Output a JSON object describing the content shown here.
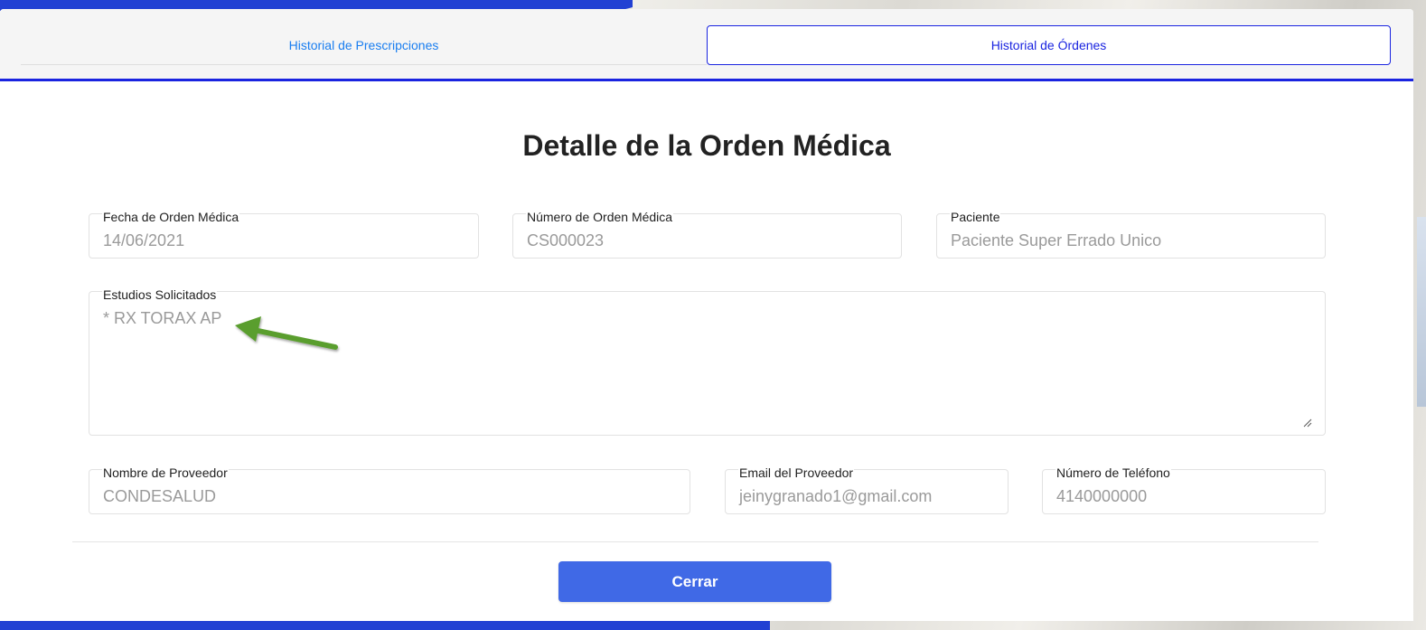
{
  "tabs": [
    {
      "label": "Historial de Prescripciones",
      "active": false
    },
    {
      "label": "Historial de Órdenes",
      "active": true
    }
  ],
  "title": "Detalle de la Orden Médica",
  "fields": {
    "fecha": {
      "label": "Fecha de Orden Médica",
      "value": "14/06/2021"
    },
    "numero": {
      "label": "Número de Orden Médica",
      "value": "CS000023"
    },
    "paciente": {
      "label": "Paciente",
      "value": "Paciente Super Errado Unico"
    },
    "estudios": {
      "label": "Estudios Solicitados",
      "value": "* RX TORAX AP"
    },
    "proveedor": {
      "label": "Nombre de Proveedor",
      "value": "CONDESALUD"
    },
    "email": {
      "label": "Email del Proveedor",
      "value": "jeinygranado1@gmail.com"
    },
    "telefono": {
      "label": "Número de Teléfono",
      "value": "4140000000"
    }
  },
  "close_label": "Cerrar",
  "colors": {
    "accent": "#1a24e0",
    "tab_link": "#1a7ef0",
    "button": "#4069e6",
    "annotation_arrow": "#5a9e2f"
  },
  "icons": {
    "annotation": "green-arrow-icon",
    "resize": "resize-grip-icon"
  }
}
